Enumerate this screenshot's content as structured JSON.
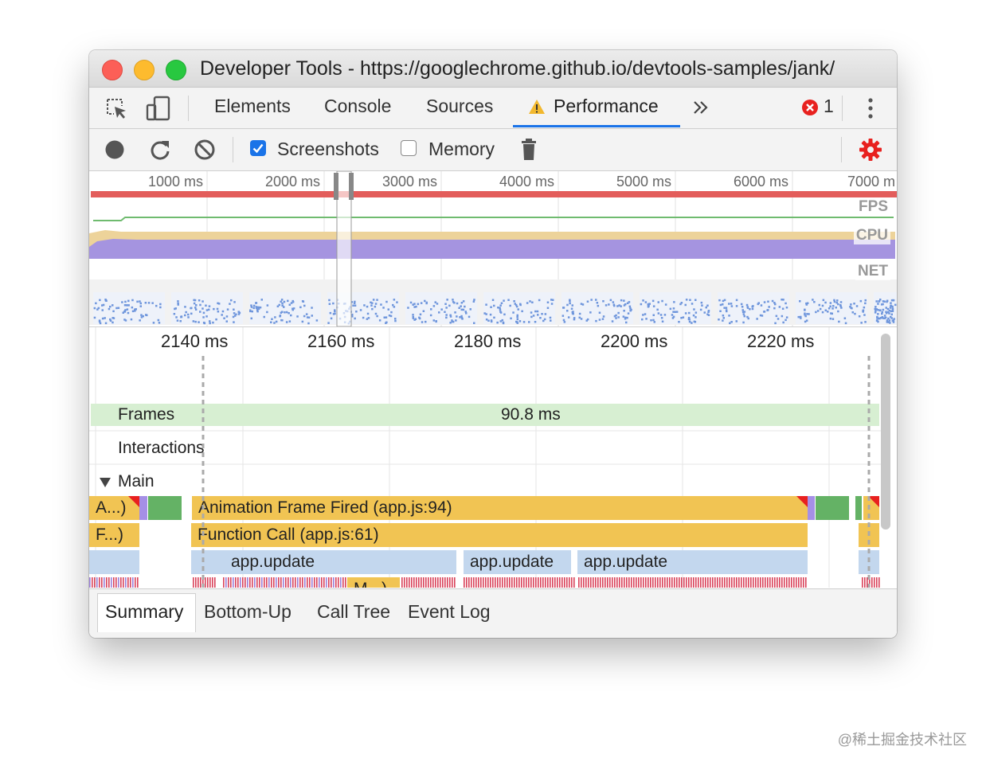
{
  "window": {
    "title": "Developer Tools - https://googlechrome.github.io/devtools-samples/jank/"
  },
  "tabbar": {
    "tabs": [
      {
        "label": "Elements"
      },
      {
        "label": "Console"
      },
      {
        "label": "Sources"
      },
      {
        "label": "Performance",
        "active": true,
        "warning_icon": "warning-triangle-icon"
      }
    ],
    "more_icon": "chevron-double-right-icon",
    "error_count": "1",
    "menu_icon": "kebab-menu-icon"
  },
  "toolbar": {
    "screenshots_label": "Screenshots",
    "screenshots_checked": true,
    "memory_label": "Memory",
    "memory_checked": false,
    "icons": [
      "record-icon",
      "reload-icon",
      "clear-icon",
      "trash-icon",
      "settings-gear-icon"
    ]
  },
  "overview": {
    "ticks": [
      "1000 ms",
      "2000 ms",
      "3000 ms",
      "4000 ms",
      "5000 ms",
      "6000 ms",
      "7000 m"
    ],
    "fps_label": "FPS",
    "cpu_label": "CPU",
    "net_label": "NET"
  },
  "timeline": {
    "ticks": [
      "2140 ms",
      "2160 ms",
      "2180 ms",
      "2200 ms",
      "2220 ms"
    ],
    "frames_label": "Frames",
    "frame_duration": "90.8 ms",
    "interactions_label": "Interactions",
    "main_label": "Main",
    "events": {
      "af_short": "A...)",
      "animation_frame": "Animation Frame Fired (app.js:94)",
      "fc_short": "F...)",
      "function_call": "Function Call (app.js:61)",
      "app_update_1": "app.update",
      "app_update_2": "app.update",
      "app_update_3": "app.update",
      "m_short": "M...)"
    }
  },
  "bottom_tabs": [
    {
      "label": "Summary",
      "active": true
    },
    {
      "label": "Bottom-Up"
    },
    {
      "label": "Call Tree"
    },
    {
      "label": "Event Log"
    }
  ],
  "watermark": "@稀土掘金技术社区",
  "colors": {
    "accent": "#1a73e8",
    "error": "#e8211f",
    "task_yellow": "#f1c453",
    "script_blue": "#c3d7ee",
    "paint_green": "#64b265",
    "render_purple": "#a58fe6"
  }
}
